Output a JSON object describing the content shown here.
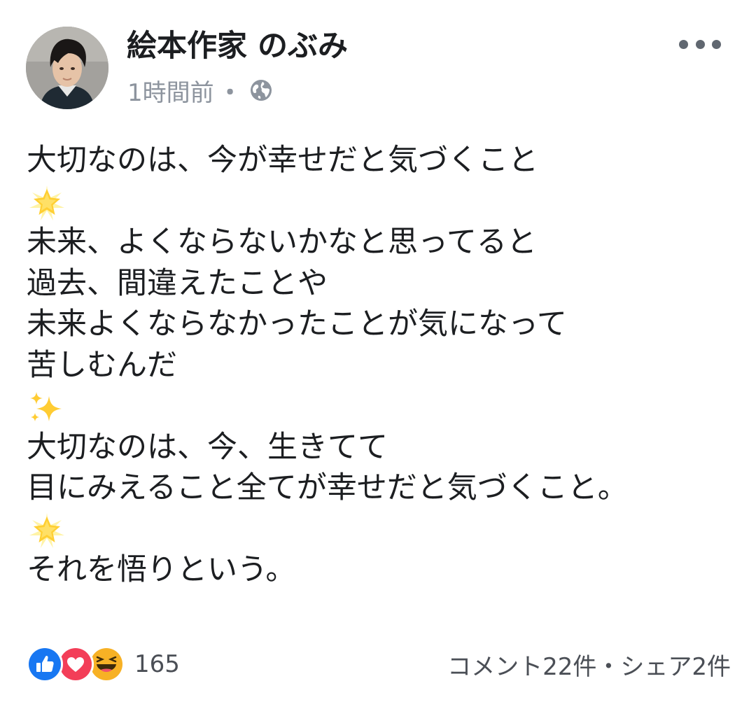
{
  "post": {
    "author": "絵本作家 のぶみ",
    "timestamp": "1時間前",
    "separator": "・",
    "audience_icon": "globe-icon",
    "more_icon": "more-horizontal-icon",
    "body_lines": [
      "大切なのは、今が幸せだと気づくこと",
      "",
      "未来、よくならないかなと思ってると",
      "過去、間違えたことや",
      "未来よくならなかったことが気になって",
      "苦しむんだ",
      "",
      "大切なのは、今、生きてて",
      "目にみえること全てが幸せだと気づくこと。",
      "",
      "それを悟りという。"
    ],
    "emoji_lines": {
      "1": "glowing-star-emoji",
      "6": "sparkles-emoji",
      "9": "glowing-star-emoji"
    }
  },
  "footer": {
    "reaction_icons": [
      "like-icon",
      "love-icon",
      "haha-icon"
    ],
    "reaction_count": "165",
    "comments": "コメント22件",
    "separator": "・",
    "shares": "シェア2件"
  },
  "colors": {
    "text": "#1c1e21",
    "meta": "#8d949e",
    "like": "#1877f2",
    "love": "#f33e58",
    "haha": "#f7b125",
    "star": "#ffd43b"
  }
}
